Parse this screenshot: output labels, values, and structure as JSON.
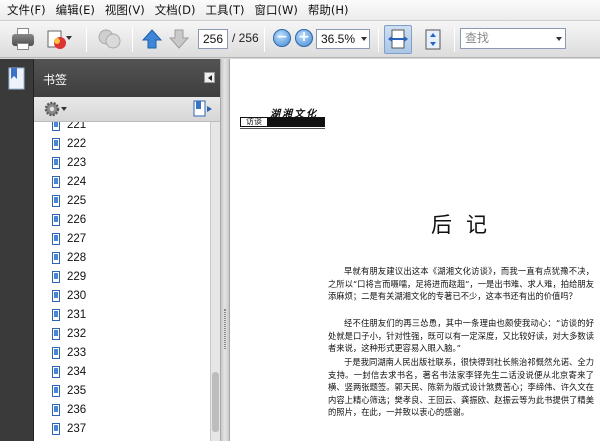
{
  "menu": [
    "文件(F)",
    "编辑(E)",
    "视图(V)",
    "文档(D)",
    "工具(T)",
    "窗口(W)",
    "帮助(H)"
  ],
  "toolbar": {
    "page_current": "256",
    "page_total": "/ 256",
    "zoom": "36.5%",
    "search_placeholder": "查找"
  },
  "sidebar": {
    "title": "书签",
    "partial_item": "221",
    "bookmarks": [
      "222",
      "223",
      "224",
      "225",
      "226",
      "227",
      "228",
      "229",
      "230",
      "231",
      "232",
      "233",
      "234",
      "235",
      "236",
      "237"
    ]
  },
  "document": {
    "header": "湖湘文化",
    "section_label": "访谈",
    "title": "后记",
    "paragraphs": [
      "早就有朋友建议出这本《湖湘文化访谈》，而我一直有点犹豫不决，之所以“口将言而嗫嚅，足将进而趑趄”，一是出书难、求人难，拍给朋友添麻烦；二是有关湖湘文化的专著已不少，这本书还有出的价值吗？",
      "经不住朋友们的再三怂恿，其中一条理由也颇使我动心：“访谈的好处就是口子小，针对性强，既可以有一定深度，又比较好读，对大多数读者来说，这种形式更容易入眼入脑。”",
      "于是我同湖南人民出版社联系，很快得到社长熊治祁慨然允诺、全力支持。一封信去求书名，著名书法家李铎先生二话没说便从北京寄来了横、竖两张题签。郭天民、陈新为版式设计煞费苦心；李缔伟、许久文在内容上精心筛选；樊孝良、王回云、龚振欧、赵振云等为此书提供了精美的照片，在此，一并致以衷心的感谢。"
    ]
  }
}
